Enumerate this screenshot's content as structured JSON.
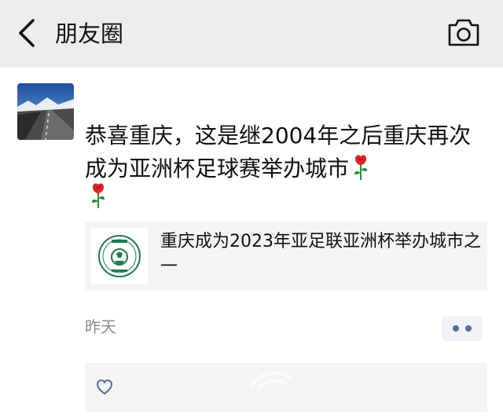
{
  "nav": {
    "title": "朋友圈",
    "back_icon": "chevron-left-icon",
    "camera_icon": "camera-icon"
  },
  "post": {
    "author": "",
    "text": "恭喜重庆，这是继2004年之后重庆再次成为亚洲杯足球赛举办城市",
    "emoji": [
      "rose",
      "rose"
    ],
    "link_card": {
      "title": "重庆成为2023年亚足联亚洲杯举办城市之一",
      "thumb_icon": "football-association-logo"
    },
    "time": "昨天",
    "more_icon": "more-dots-icon"
  },
  "likes": {
    "icon": "heart-outline-icon",
    "names": ""
  },
  "colors": {
    "nav_bg": "#ededed",
    "link_blue": "#576b95",
    "card_bg": "#f4f4f4",
    "time_gray": "#8c8c8c",
    "rose_red": "#d9242a",
    "leaf_green": "#2e8b3a"
  }
}
